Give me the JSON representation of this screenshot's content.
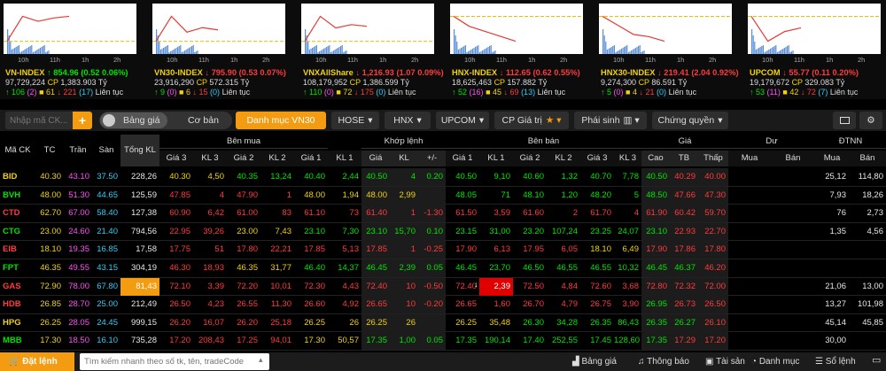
{
  "indices": [
    {
      "name": "VN-INDEX",
      "value": "854.96",
      "change": "0.52",
      "pct": "0.06%",
      "dir": "up",
      "vol": "97,729,224",
      "cp": "1,383.903",
      "unit": "Tỷ",
      "up": "106",
      "ce": "2",
      "ref": "61",
      "dn": "221",
      "fl": "17",
      "status": "Liên tục"
    },
    {
      "name": "VN30-INDEX",
      "value": "795.90",
      "change": "0.53",
      "pct": "0.07%",
      "dir": "dn",
      "vol": "23,916,290",
      "cp": "572.315",
      "unit": "Tỷ",
      "up": "9",
      "ce": "0",
      "ref": "6",
      "dn": "15",
      "fl": "0",
      "status": "Liên tục"
    },
    {
      "name": "VNXAllShare",
      "value": "1,216.93",
      "change": "1.07",
      "pct": "0.09%",
      "dir": "dn",
      "vol": "108,179,952",
      "cp": "1,386.599",
      "unit": "Tỷ",
      "up": "110",
      "ce": "0",
      "ref": "72",
      "dn": "175",
      "fl": "0",
      "status": "Liên tục"
    },
    {
      "name": "HNX-INDEX",
      "value": "112.65",
      "change": "0.62",
      "pct": "0.55%",
      "dir": "dn",
      "vol": "18,625,463",
      "cp": "157.882",
      "unit": "Tỷ",
      "up": "52",
      "ce": "16",
      "ref": "45",
      "dn": "69",
      "fl": "13",
      "status": "Liên tục"
    },
    {
      "name": "HNX30-INDEX",
      "value": "219.41",
      "change": "2.04",
      "pct": "0.92%",
      "dir": "dn",
      "vol": "9,274,300",
      "cp": "86.591",
      "unit": "Tỷ",
      "up": "5",
      "ce": "0",
      "ref": "4",
      "dn": "21",
      "fl": "0",
      "status": "Liên tục"
    },
    {
      "name": "UPCOM",
      "value": "55.77",
      "change": "0.11",
      "pct": "0.20%",
      "dir": "dn",
      "vol": "19,179,672",
      "cp": "329.083",
      "unit": "Tỷ",
      "up": "53",
      "ce": "11",
      "ref": "42",
      "dn": "72",
      "fl": "7",
      "status": "Liên tục"
    }
  ],
  "chart_times": [
    "10h",
    "11h",
    "1h",
    "2h"
  ],
  "chart_data": [
    {
      "type": "line",
      "title": "VN-INDEX",
      "x": [
        "10h",
        "11h",
        "1h",
        "2h"
      ],
      "series": [
        {
          "values": [
            854.4,
            855.9,
            855.6,
            855.8,
            855.9
          ]
        }
      ]
    },
    {
      "type": "line",
      "title": "VN30-INDEX",
      "x": [
        "10h",
        "11h",
        "1h",
        "2h"
      ],
      "series": [
        {
          "values": [
            796.4,
            797.5,
            796.8,
            797.0,
            796.9
          ]
        }
      ]
    },
    {
      "type": "line",
      "title": "VNXAllShare",
      "x": [
        "10h",
        "11h",
        "1h",
        "2h"
      ],
      "series": [
        {
          "values": [
            1218.0,
            1219.5,
            1218.8,
            1219.0,
            1218.9
          ]
        }
      ]
    },
    {
      "type": "line",
      "title": "HNX-INDEX",
      "x": [
        "10h",
        "11h",
        "1h",
        "2h"
      ],
      "series": [
        {
          "values": [
            113.3,
            113.1,
            113.0,
            112.9,
            112.8
          ]
        }
      ]
    },
    {
      "type": "line",
      "title": "HNX30-INDEX",
      "x": [
        "10h",
        "11h",
        "1h",
        "2h"
      ],
      "series": [
        {
          "values": [
            221.4,
            221.0,
            220.6,
            220.5,
            220.3
          ]
        }
      ]
    },
    {
      "type": "line",
      "title": "UPCOM",
      "x": [
        "10h",
        "11h",
        "1h",
        "2h"
      ],
      "series": [
        {
          "values": [
            55.88,
            55.75,
            55.8,
            55.82
          ]
        }
      ]
    }
  ],
  "toolbar": {
    "search_placeholder": "Nhập mã CK...",
    "toggle_left": "Bảng giá",
    "toggle_right": "Cơ bản",
    "tabs": [
      "Danh mục VN30",
      "HOSE",
      "HNX",
      "UPCOM",
      "CP Giá trị",
      "Phái sinh",
      "Chứng quyền"
    ]
  },
  "headers": {
    "symbol": "Mã CK",
    "ref": "TC",
    "ceil": "Trần",
    "floor": "Sàn",
    "total": "Tổng KL",
    "buy": "Bên mua",
    "match": "Khớp lệnh",
    "sell": "Bên bán",
    "price": "Giá",
    "rem": "Dư",
    "foreign": "ĐTNN",
    "sub": [
      "Giá 3",
      "KL 3",
      "Giá 2",
      "KL 2",
      "Giá 1",
      "KL 1",
      "Giá",
      "KL",
      "+/-",
      "Giá 1",
      "KL 1",
      "Giá 2",
      "KL 2",
      "Giá 3",
      "KL 3",
      "Cao",
      "TB",
      "Thấp",
      "Mua",
      "Bán",
      "Mua",
      "Bán"
    ]
  },
  "rows": [
    {
      "s": "BID",
      "c": "ref",
      "v": [
        "40.30",
        "43.10",
        "37.50",
        "228,26",
        "40.30",
        "4,50",
        "40.35",
        "13,24",
        "40.40",
        "2,44",
        "40.50",
        "4",
        "0.20",
        "40.50",
        "9,10",
        "40.60",
        "1,32",
        "40.70",
        "7,78",
        "40.50",
        "40.29",
        "40.00",
        "",
        "",
        "25,12",
        "114,80"
      ],
      "k": [
        "ref",
        "ce",
        "fl",
        "wh",
        "ref",
        "ref",
        "up",
        "up",
        "up",
        "up",
        "up",
        "up",
        "up",
        "up",
        "up",
        "up",
        "up",
        "up",
        "up",
        "up",
        "dn",
        "dn",
        "",
        "",
        "wh",
        "wh"
      ]
    },
    {
      "s": "BVH",
      "c": "up",
      "v": [
        "48.00",
        "51.30",
        "44.65",
        "125,59",
        "47.85",
        "4",
        "47.90",
        "1",
        "48.00",
        "1,94",
        "48.00",
        "2,99",
        "",
        "48.05",
        "71",
        "48.10",
        "1,20",
        "48.20",
        "5",
        "48.50",
        "47.66",
        "47.30",
        "",
        "",
        "7,93",
        "18,26"
      ],
      "k": [
        "ref",
        "ce",
        "fl",
        "wh",
        "dn",
        "dn",
        "dn",
        "dn",
        "ref",
        "ref",
        "ref",
        "ref",
        "",
        "up",
        "up",
        "up",
        "up",
        "up",
        "up",
        "up",
        "dn",
        "dn",
        "",
        "",
        "wh",
        "wh"
      ]
    },
    {
      "s": "CTD",
      "c": "dn",
      "v": [
        "62.70",
        "67.00",
        "58.40",
        "127,38",
        "60.90",
        "6,42",
        "61.00",
        "83",
        "61.10",
        "73",
        "61.40",
        "1",
        "-1.30",
        "61.50",
        "3,59",
        "61.60",
        "2",
        "61.70",
        "4",
        "61.90",
        "60.42",
        "59.70",
        "",
        "",
        "76",
        "2,73"
      ],
      "k": [
        "ref",
        "ce",
        "fl",
        "wh",
        "dn",
        "dn",
        "dn",
        "dn",
        "dn",
        "dn",
        "dn",
        "dn",
        "dn",
        "dn",
        "dn",
        "dn",
        "dn",
        "dn",
        "dn",
        "dn",
        "dn",
        "dn",
        "",
        "",
        "wh",
        "wh"
      ]
    },
    {
      "s": "CTG",
      "c": "up",
      "v": [
        "23.00",
        "24.60",
        "21.40",
        "794,56",
        "22.95",
        "39,26",
        "23.00",
        "7,43",
        "23.10",
        "7,30",
        "23.10",
        "15,70",
        "0.10",
        "23.15",
        "31,00",
        "23.20",
        "107,24",
        "23.25",
        "24,07",
        "23.10",
        "22.93",
        "22.70",
        "",
        "",
        "1,35",
        "4,56"
      ],
      "k": [
        "ref",
        "ce",
        "fl",
        "wh",
        "dn",
        "dn",
        "ref",
        "ref",
        "up",
        "up",
        "up",
        "up",
        "up",
        "up",
        "up",
        "up",
        "up",
        "up",
        "up",
        "up",
        "dn",
        "dn",
        "",
        "",
        "wh",
        "wh"
      ]
    },
    {
      "s": "EIB",
      "c": "dn",
      "v": [
        "18.10",
        "19.35",
        "16.85",
        "17,58",
        "17.75",
        "51",
        "17.80",
        "22,21",
        "17.85",
        "5,13",
        "17.85",
        "1",
        "-0.25",
        "17.90",
        "6,13",
        "17.95",
        "6,05",
        "18.10",
        "6,49",
        "17.90",
        "17.86",
        "17.80",
        "",
        "",
        "",
        ""
      ],
      "k": [
        "ref",
        "ce",
        "fl",
        "wh",
        "dn",
        "dn",
        "dn",
        "dn",
        "dn",
        "dn",
        "dn",
        "dn",
        "dn",
        "dn",
        "dn",
        "dn",
        "dn",
        "ref",
        "ref",
        "dn",
        "dn",
        "dn",
        "",
        "",
        "",
        ""
      ]
    },
    {
      "s": "FPT",
      "c": "up",
      "v": [
        "46.35",
        "49.55",
        "43.15",
        "304,19",
        "46.30",
        "18,93",
        "46.35",
        "31,77",
        "46.40",
        "14,37",
        "46.45",
        "2,39",
        "0.05",
        "46.45",
        "23,70",
        "46.50",
        "46,55",
        "46.55",
        "10,32",
        "46.45",
        "46.37",
        "46.20",
        "",
        "",
        "",
        ""
      ],
      "k": [
        "ref",
        "ce",
        "fl",
        "wh",
        "dn",
        "dn",
        "ref",
        "ref",
        "up",
        "up",
        "up",
        "up",
        "up",
        "up",
        "up",
        "up",
        "up",
        "up",
        "up",
        "up",
        "up",
        "dn",
        "",
        "",
        "",
        ""
      ]
    },
    {
      "s": "GAS",
      "c": "dn",
      "v": [
        "72.90",
        "78.00",
        "67.80",
        "81,43",
        "72.10",
        "3,39",
        "72.20",
        "10,01",
        "72.30",
        "4,43",
        "72.40",
        "10",
        "-0.50",
        "72.40",
        "2,39",
        "72.50",
        "4,84",
        "72.60",
        "3,68",
        "72.80",
        "72.32",
        "72.00",
        "",
        "",
        "21,06",
        "13,00"
      ],
      "k": [
        "ref",
        "ce",
        "fl",
        "wh",
        "dn",
        "dn",
        "dn",
        "dn",
        "dn",
        "dn",
        "dn",
        "dn",
        "dn",
        "dn",
        "wh",
        "dn",
        "dn",
        "dn",
        "dn",
        "dn",
        "dn",
        "dn",
        "",
        "",
        "wh",
        "wh"
      ]
    },
    {
      "s": "HDB",
      "c": "dn",
      "v": [
        "26.85",
        "28.70",
        "25.00",
        "212,49",
        "26.50",
        "4,23",
        "26.55",
        "11,30",
        "26.60",
        "4,92",
        "26.65",
        "10",
        "-0.20",
        "26.65",
        "1,60",
        "26.70",
        "4,79",
        "26.75",
        "3,90",
        "26.95",
        "26.73",
        "26.50",
        "",
        "",
        "13,27",
        "101,98"
      ],
      "k": [
        "ref",
        "ce",
        "fl",
        "wh",
        "dn",
        "dn",
        "dn",
        "dn",
        "dn",
        "dn",
        "dn",
        "dn",
        "dn",
        "dn",
        "dn",
        "dn",
        "dn",
        "dn",
        "dn",
        "up",
        "dn",
        "dn",
        "",
        "",
        "wh",
        "wh"
      ]
    },
    {
      "s": "HPG",
      "c": "ref",
      "v": [
        "26.25",
        "28.05",
        "24.45",
        "999,15",
        "26.20",
        "16,07",
        "26.20",
        "25,18",
        "26.25",
        "26",
        "26.25",
        "26",
        "",
        "26.25",
        "35,48",
        "26.30",
        "34,28",
        "26.35",
        "86,43",
        "26.35",
        "26.27",
        "26.10",
        "",
        "",
        "45,14",
        "45,85"
      ],
      "k": [
        "ref",
        "ce",
        "fl",
        "wh",
        "dn",
        "dn",
        "dn",
        "dn",
        "ref",
        "ref",
        "ref",
        "ref",
        "",
        "ref",
        "ref",
        "up",
        "up",
        "up",
        "up",
        "up",
        "up",
        "dn",
        "",
        "",
        "wh",
        "wh"
      ]
    },
    {
      "s": "MBB",
      "c": "up",
      "v": [
        "17.30",
        "18.50",
        "16.10",
        "735,28",
        "17.20",
        "208,43",
        "17.25",
        "94,01",
        "17.30",
        "50,57",
        "17.35",
        "1,00",
        "0.05",
        "17.35",
        "190,14",
        "17.40",
        "252,55",
        "17.45",
        "128,60",
        "17.35",
        "17.29",
        "17.20",
        "",
        "",
        "30,00",
        ""
      ],
      "k": [
        "ref",
        "ce",
        "fl",
        "wh",
        "dn",
        "dn",
        "dn",
        "dn",
        "ref",
        "ref",
        "up",
        "up",
        "up",
        "up",
        "up",
        "up",
        "up",
        "up",
        "up",
        "up",
        "dn",
        "dn",
        "",
        "",
        "wh",
        ""
      ]
    }
  ],
  "footer": {
    "order": "Đặt lệnh",
    "search_placeholder": "Tìm kiếm nhanh theo số tk, tên, tradeCode",
    "board": "Bảng giá",
    "notice": "Thông báo",
    "assets": "Tài sản",
    "portfolio": "Danh mục",
    "orderbook": "Sổ lệnh"
  },
  "colors": {
    "up": "#00e400",
    "down": "#ff3b3b",
    "ref": "#f2d20a",
    "ceil": "#ff4ff5",
    "floor": "#33ccf3",
    "accent": "#f39c12"
  }
}
